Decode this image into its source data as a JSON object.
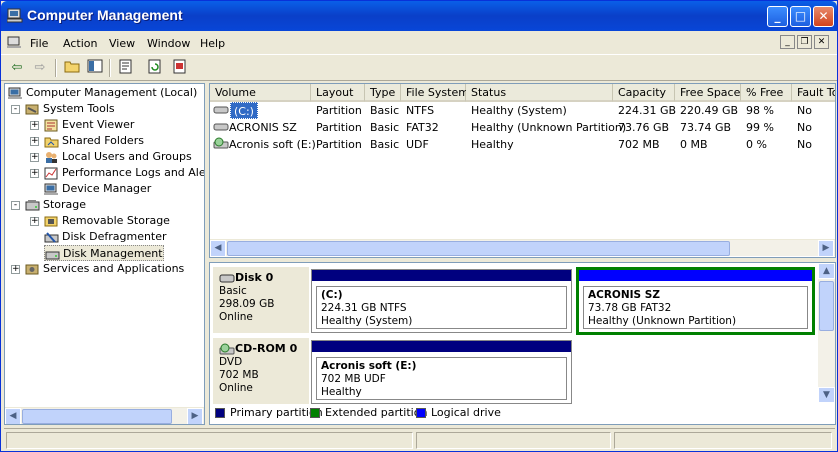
{
  "window": {
    "title": "Computer Management"
  },
  "menus": [
    "File",
    "Action",
    "View",
    "Window",
    "Help"
  ],
  "tree": {
    "root": "Computer Management (Local)",
    "system_tools": "System Tools",
    "event_viewer": "Event Viewer",
    "shared_folders": "Shared Folders",
    "local_users": "Local Users and Groups",
    "perf_logs": "Performance Logs and Alerts",
    "device_manager": "Device Manager",
    "storage": "Storage",
    "removable": "Removable Storage",
    "defrag": "Disk Defragmenter",
    "disk_mgmt": "Disk Management",
    "services": "Services and Applications"
  },
  "columns": [
    "Volume",
    "Layout",
    "Type",
    "File System",
    "Status",
    "Capacity",
    "Free Space",
    "% Free",
    "Fault To"
  ],
  "volumes": [
    [
      "(C:)",
      "Partition",
      "Basic",
      "NTFS",
      "Healthy (System)",
      "224.31 GB",
      "220.49 GB",
      "98 %",
      "No"
    ],
    [
      "ACRONIS SZ",
      "Partition",
      "Basic",
      "FAT32",
      "Healthy (Unknown Partition)",
      "73.76 GB",
      "73.74 GB",
      "99 %",
      "No"
    ],
    [
      "Acronis soft (E:)",
      "Partition",
      "Basic",
      "UDF",
      "Healthy",
      "702 MB",
      "0 MB",
      "0 %",
      "No"
    ]
  ],
  "disk0": {
    "name": "Disk 0",
    "type": "Basic",
    "size": "298.09 GB",
    "state": "Online",
    "p1": {
      "title": "(C:)",
      "info": "224.31 GB NTFS",
      "status": "Healthy (System)"
    },
    "p2": {
      "title": "ACRONIS SZ",
      "info": "73.78 GB FAT32",
      "status": "Healthy (Unknown Partition)"
    }
  },
  "cdrom0": {
    "name": "CD-ROM 0",
    "type": "DVD",
    "size": "702 MB",
    "state": "Online",
    "p1": {
      "title": "Acronis soft  (E:)",
      "info": "702 MB UDF",
      "status": "Healthy"
    }
  },
  "legend": [
    "Primary partition",
    "Extended partition",
    "Logical drive"
  ],
  "colors": {
    "primary": "#00007F",
    "extended": "#008000",
    "logical": "#0000FF",
    "titlebar": "#0A5FE8"
  }
}
